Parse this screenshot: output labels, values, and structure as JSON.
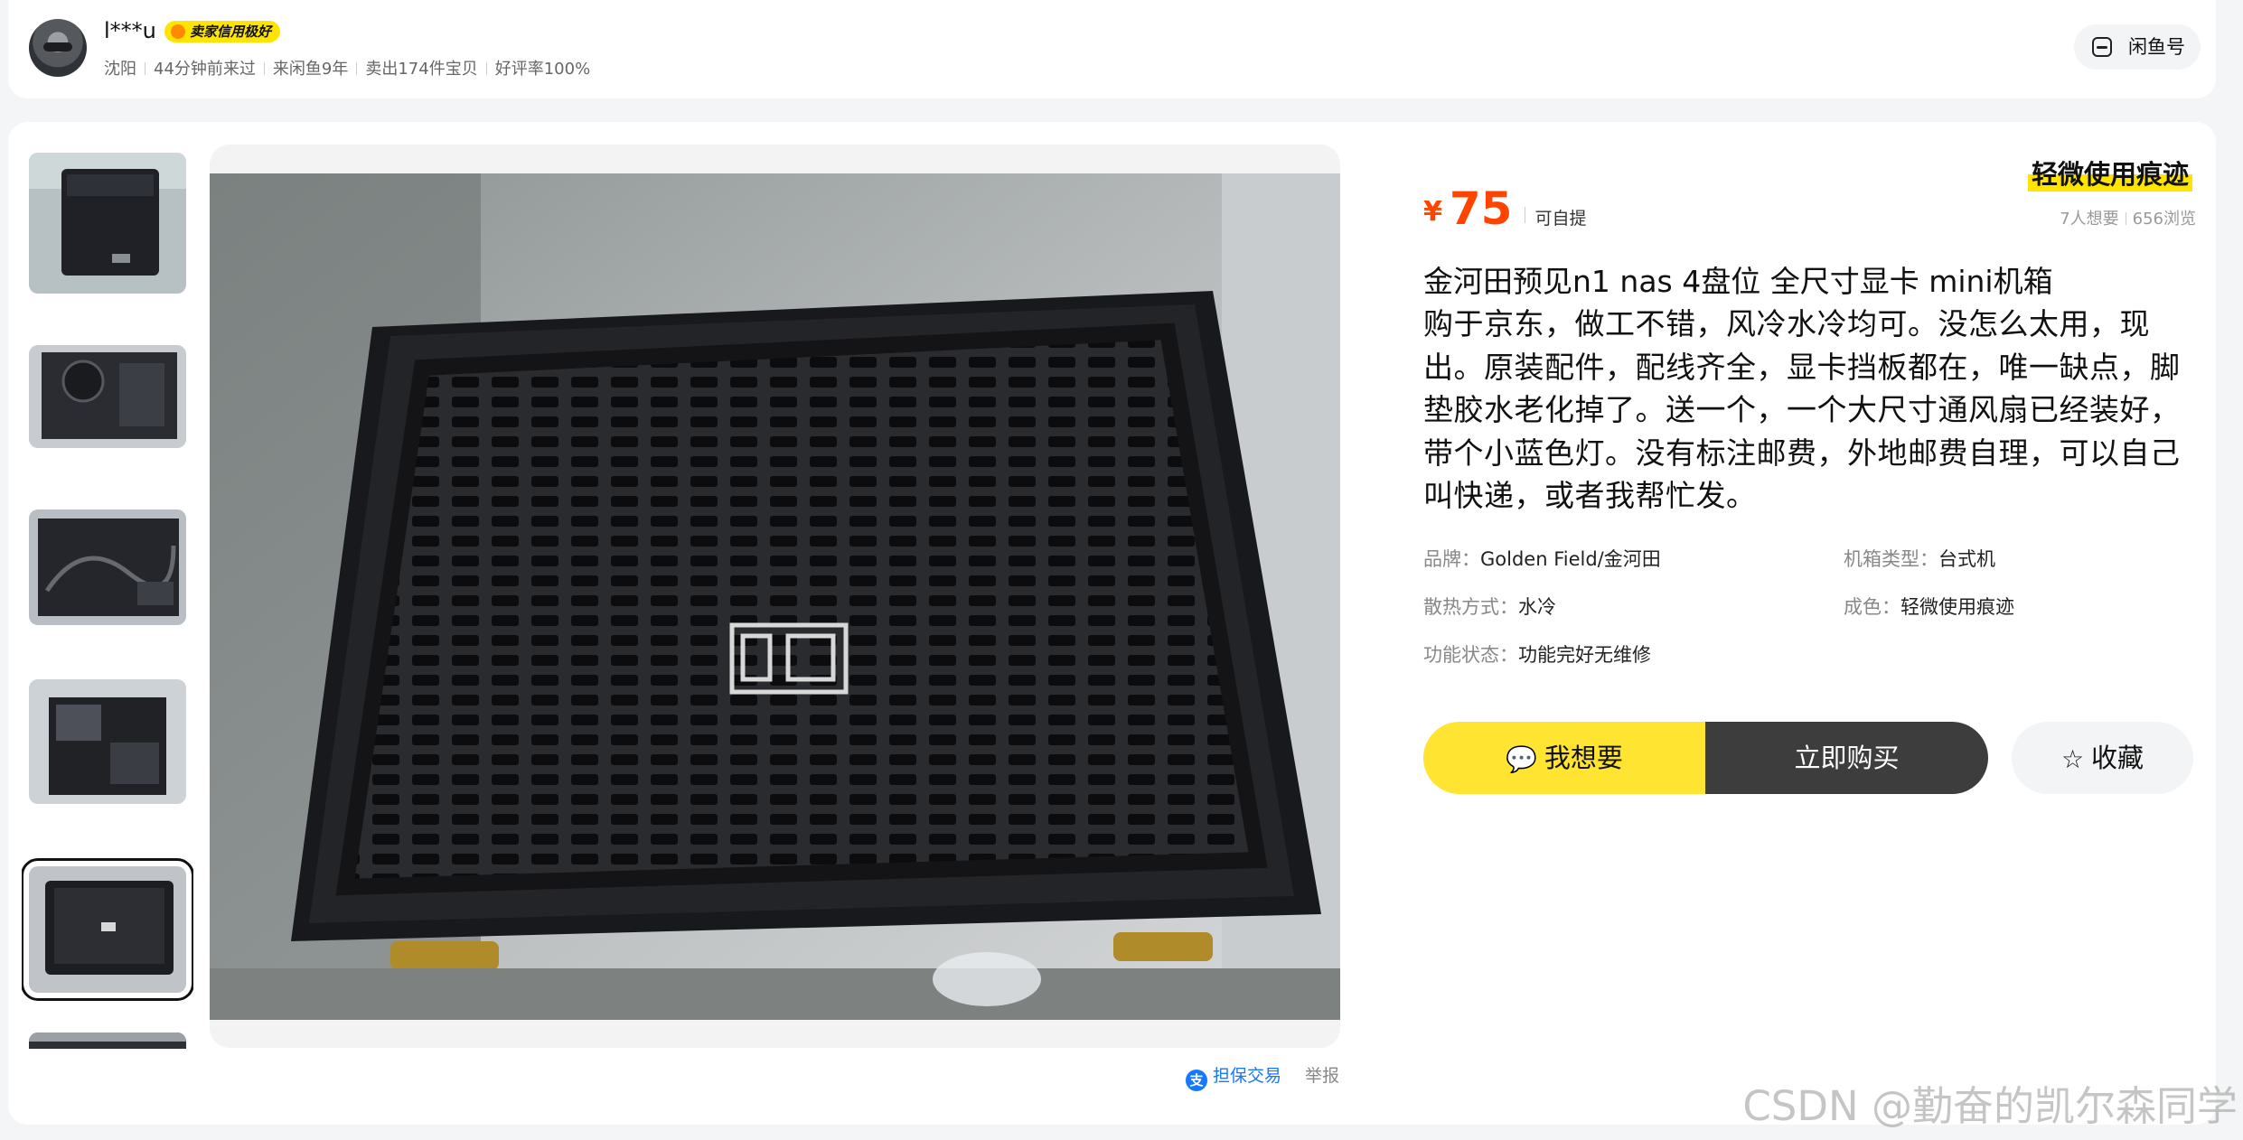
{
  "seller": {
    "name": "l***u",
    "credit_badge": "卖家信用极好",
    "location": "沈阳",
    "last_seen": "44分钟前来过",
    "years": "来闲鱼9年",
    "sold": "卖出174件宝贝",
    "rating": "好评率100%",
    "xianyu_label": "闲鱼号"
  },
  "product": {
    "condition_tag": "轻微使用痕迹",
    "currency": "¥",
    "price": "75",
    "price_extra": "可自提",
    "wants": "7人想要",
    "views": "656浏览",
    "title": "金河田预见n1 nas 4盘位 全尺寸显卡 mini机箱",
    "description": "购于京东，做工不错，风冷水冷均可。没怎么太用，现出。原装配件，配线齐全，显卡挡板都在，唯一缺点，脚垫胶水老化掉了。送一个，一个大尺寸通风扇已经装好，带个小蓝色灯。没有标注邮费，外地邮费自理，可以自己叫快递，或者我帮忙发。",
    "attributes": [
      {
        "key": "品牌：",
        "value": "Golden Field/金河田"
      },
      {
        "key": "机箱类型：",
        "value": "台式机"
      },
      {
        "key": "散热方式：",
        "value": "水冷"
      },
      {
        "key": "成色：",
        "value": "轻微使用痕迹"
      },
      {
        "key": "功能状态：",
        "value": "功能完好无维修"
      }
    ]
  },
  "actions": {
    "want": "我想要",
    "buy": "立即购买",
    "favorite": "收藏"
  },
  "footer": {
    "guarantee": "担保交易",
    "report": "举报"
  },
  "watermark": "CSDN @勤奋的凯尔森同学",
  "colors": {
    "accent_yellow": "#ffe431",
    "price_orange": "#ff4400",
    "buy_dark": "#3d3d3d",
    "link_blue": "#1677ff"
  }
}
